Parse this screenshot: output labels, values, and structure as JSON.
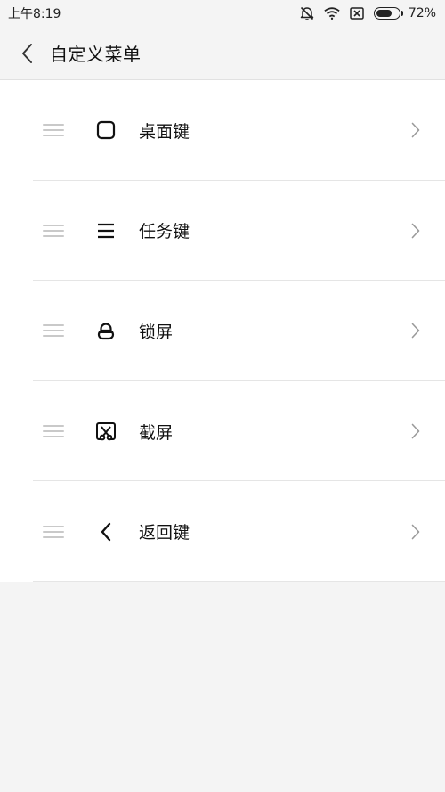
{
  "status_bar": {
    "time": "上午8:19",
    "battery_percent": "72%",
    "battery_level": 0.72,
    "icons": [
      "alarm-off-icon",
      "wifi-icon",
      "sim-blocked-icon",
      "battery-icon"
    ]
  },
  "header": {
    "title": "自定义菜单",
    "back_icon": "chevron-left-icon"
  },
  "menu": {
    "items": [
      {
        "label": "桌面键",
        "icon": "square-icon"
      },
      {
        "label": "任务键",
        "icon": "menu-lines-icon"
      },
      {
        "label": "锁屏",
        "icon": "lock-icon"
      },
      {
        "label": "截屏",
        "icon": "screenshot-scissors-icon"
      },
      {
        "label": "返回键",
        "icon": "chevron-left-icon"
      }
    ]
  },
  "colors": {
    "background": "#f4f4f4",
    "list_background": "#ffffff",
    "text": "#111111",
    "divider": "#e5e5e5",
    "handle": "#c9c9c9",
    "chevron": "#9a9a9a"
  }
}
